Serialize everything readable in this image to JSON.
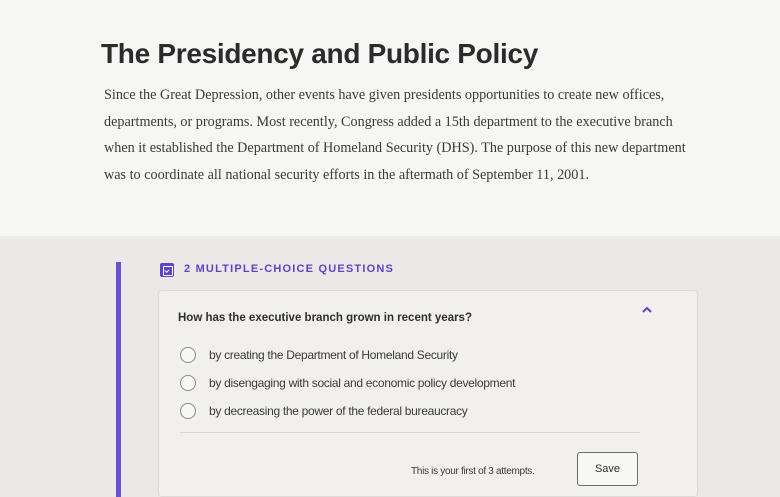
{
  "article": {
    "title": "The Presidency and Public Policy",
    "paragraph": "Since the Great Depression, other events have given presidents opportunities to create new offices, departments, or programs. Most recently, Congress added a 15th department to the executive branch when it established the Department of Homeland Security (DHS). The purpose of this new department was to coordinate all national security efforts in the aftermath of September 11, 2001."
  },
  "section": {
    "icon": "checkbox-icon",
    "label": "2 MULTIPLE-CHOICE QUESTIONS",
    "accent_color": "#5b45c4"
  },
  "question": {
    "prompt": "How has the executive branch grown in recent years?",
    "collapse_icon": "chevron-up-icon",
    "options": [
      {
        "label": "by creating the Department of Homeland Security",
        "selected": false
      },
      {
        "label": "by disengaging with social and economic policy development",
        "selected": false
      },
      {
        "label": "by decreasing the power of the federal bureaucracy",
        "selected": false
      }
    ],
    "attempts_text": "This is your first of 3 attempts.",
    "save_label": "Save"
  }
}
